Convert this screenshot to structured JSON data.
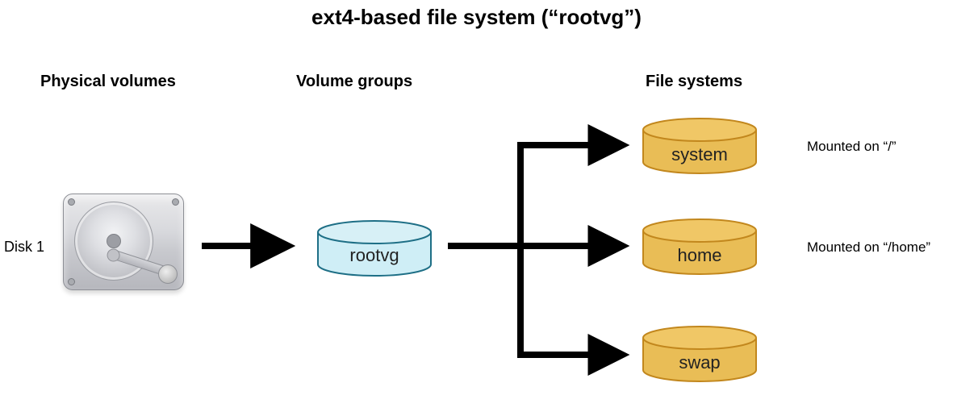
{
  "title": "ext4-based file system (“rootvg”)",
  "columns": {
    "physical": "Physical volumes",
    "groups": "Volume groups",
    "fs": "File systems"
  },
  "disk": {
    "label": "Disk 1"
  },
  "volume_group": {
    "name": "rootvg"
  },
  "filesystems": [
    {
      "name": "system",
      "caption": "Mounted on “/”"
    },
    {
      "name": "home",
      "caption": "Mounted on “/home”"
    },
    {
      "name": "swap",
      "caption": ""
    }
  ],
  "colors": {
    "vg_top": "#d7f0f6",
    "vg_side": "#cfeef6",
    "vg_stroke": "#1e6f86",
    "fs_top": "#f0c766",
    "fs_side": "#e9bd56",
    "fs_stroke": "#c2871d",
    "arrow": "#000000"
  },
  "chart_data": {
    "type": "table",
    "title": "ext4-based file system (“rootvg”)",
    "nodes": [
      {
        "id": "disk1",
        "role": "physical-volume",
        "label": "Disk 1"
      },
      {
        "id": "rootvg",
        "role": "volume-group",
        "label": "rootvg"
      },
      {
        "id": "system",
        "role": "file-system",
        "label": "system",
        "mount": "/"
      },
      {
        "id": "home",
        "role": "file-system",
        "label": "home",
        "mount": "/home"
      },
      {
        "id": "swap",
        "role": "file-system",
        "label": "swap",
        "mount": null
      }
    ],
    "edges": [
      {
        "from": "disk1",
        "to": "rootvg"
      },
      {
        "from": "rootvg",
        "to": "system"
      },
      {
        "from": "rootvg",
        "to": "home"
      },
      {
        "from": "rootvg",
        "to": "swap"
      }
    ],
    "column_headers": [
      "Physical volumes",
      "Volume groups",
      "File systems"
    ]
  }
}
